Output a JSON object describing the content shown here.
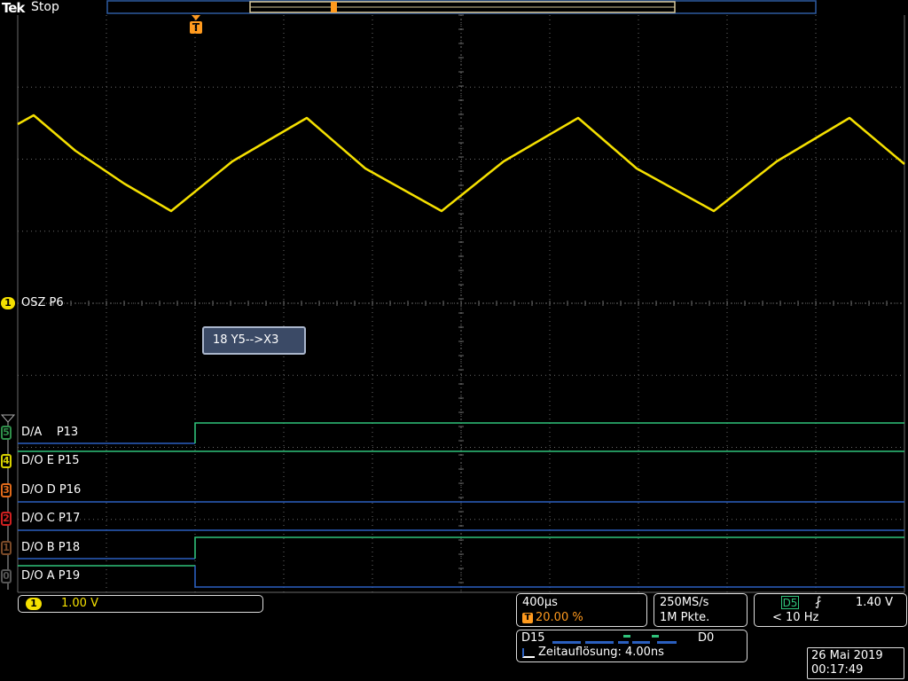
{
  "header": {
    "brand": "Tek",
    "status": "Stop",
    "trigger_marker": "T"
  },
  "analog_channel": {
    "number": "1",
    "label": "OSZ P6",
    "color": "#f5e000"
  },
  "annotation": "18 Y5-->X3",
  "digital_channels": [
    {
      "number": "5",
      "label": "D/A    P13",
      "color": "#2f8f4a"
    },
    {
      "number": "4",
      "label": "D/O E P15",
      "color": "#d8d200"
    },
    {
      "number": "3",
      "label": "D/O D P16",
      "color": "#e06a1a"
    },
    {
      "number": "2",
      "label": "D/O C P17",
      "color": "#d02020"
    },
    {
      "number": "1",
      "label": "D/O B P18",
      "color": "#7a4a28"
    },
    {
      "number": "0",
      "label": "D/O A P19",
      "color": "#555555"
    }
  ],
  "footer": {
    "ch1_number": "1",
    "ch1_scale": "1.00 V",
    "timebase": "400µs",
    "trigger_position": "20.00 %",
    "sample_rate": "250MS/s",
    "record_length": "1M Pkte.",
    "trigger_source": "D5",
    "trigger_level": "1.40 V",
    "trigger_freq": "< 10 Hz",
    "digital_range_high": "D15",
    "digital_range_low": "D0",
    "timing_resolution": "Zeitauflösung: 4.00ns",
    "date": "26 Mai  2019",
    "time": "00:17:49"
  },
  "colors": {
    "grid": "#6a6a6a",
    "signal_analog": "#f5e000",
    "signal_green": "#2fc27a",
    "signal_blue": "#2a5fbf",
    "trigger": "#ff9a1e",
    "accent_blue": "#2d5aa0"
  }
}
